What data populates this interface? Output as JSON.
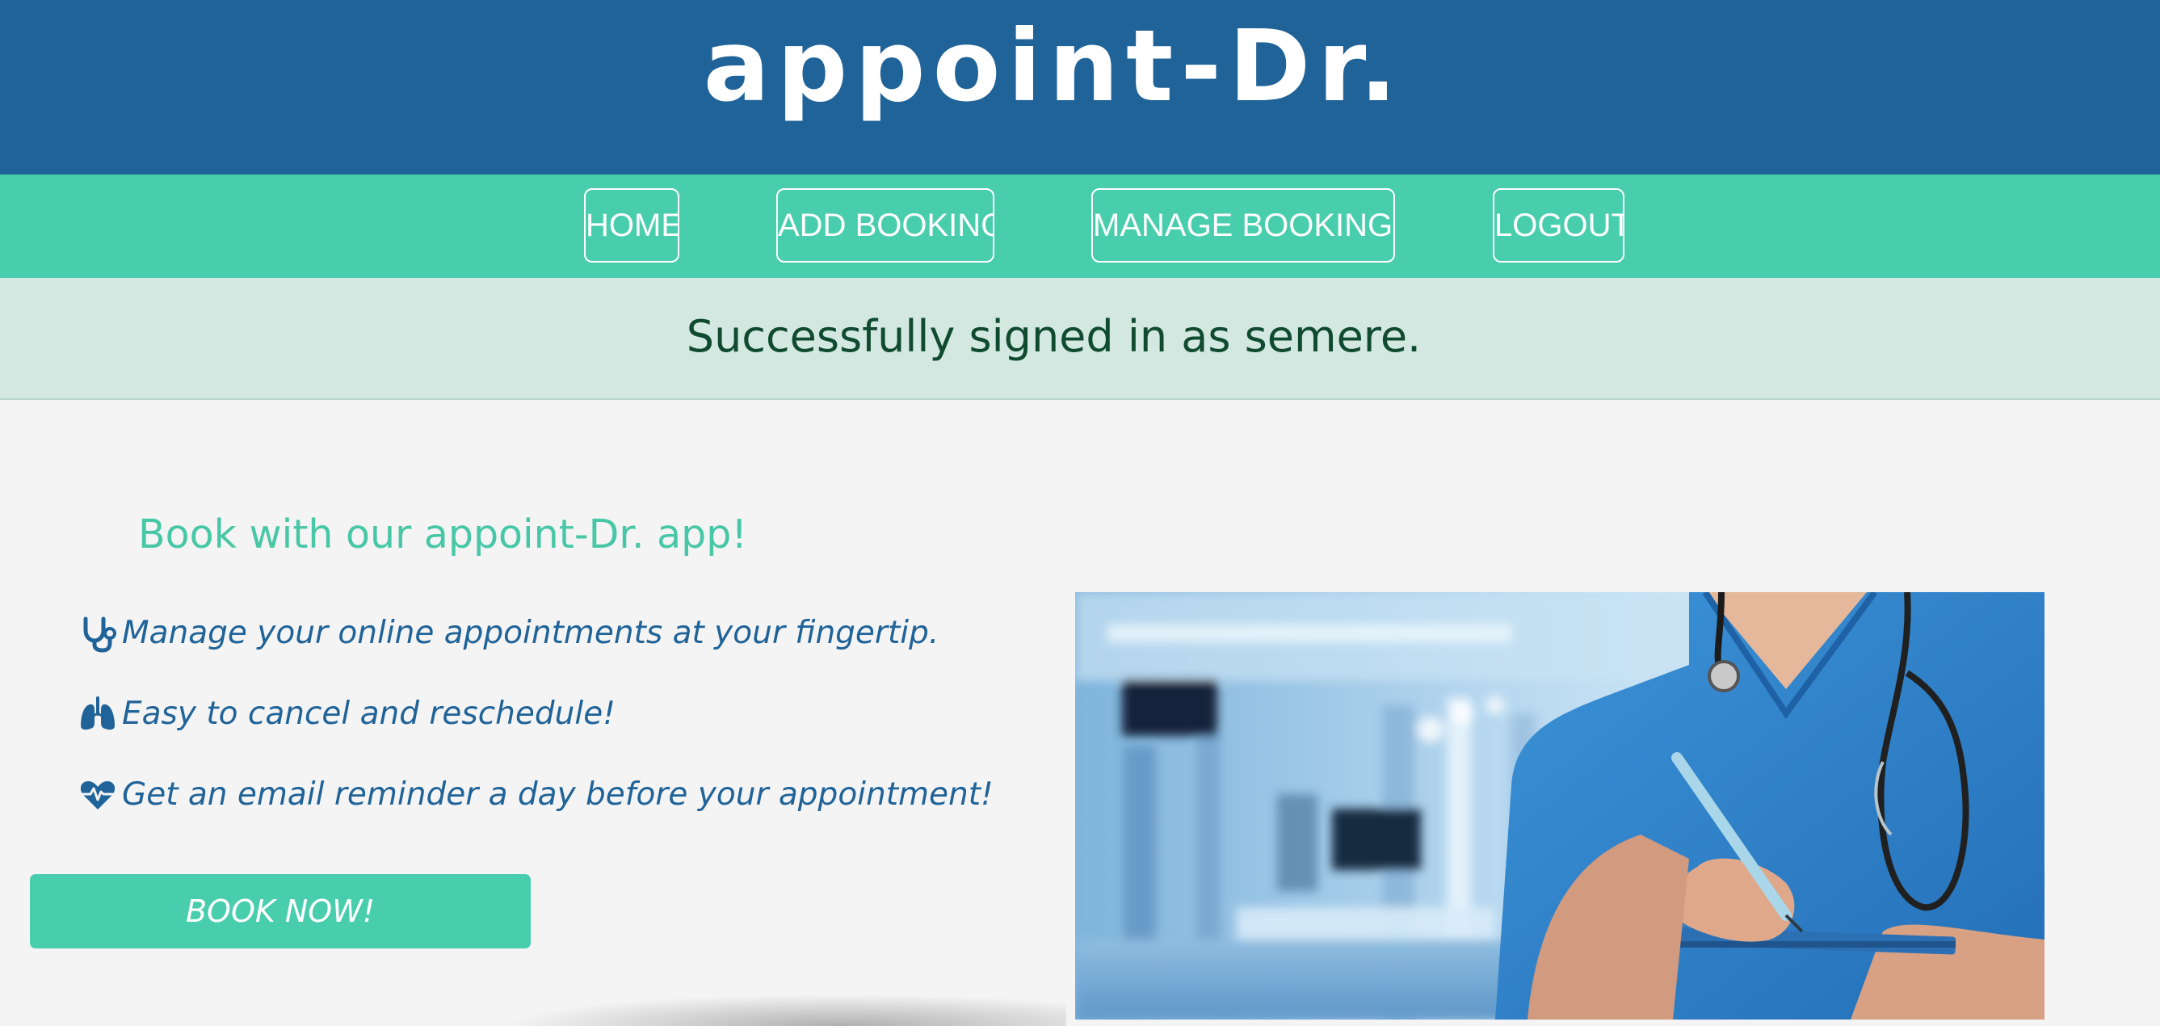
{
  "header": {
    "brand": "appoint-Dr."
  },
  "nav": {
    "items": [
      {
        "label": "HOME"
      },
      {
        "label": "ADD BOOKING"
      },
      {
        "label": "MANAGE BOOKINGS"
      },
      {
        "label": "LOGOUT"
      }
    ]
  },
  "alert": {
    "message": "Successfully signed in as semere."
  },
  "main": {
    "tagline": "Book with our appoint-Dr. app!",
    "features": [
      {
        "icon": "stethoscope-icon",
        "text": "Manage your online appointments at your fingertip."
      },
      {
        "icon": "lungs-icon",
        "text": "Easy to cancel and reschedule!"
      },
      {
        "icon": "heart-pulse-icon",
        "text": "Get an email reminder a day before your appointment!"
      }
    ],
    "cta_label": "BOOK NOW!"
  },
  "colors": {
    "header_bg": "#206398",
    "nav_bg": "#48cdad",
    "alert_bg": "#d2e8e0",
    "alert_text": "#104a30",
    "accent": "#48c7a7",
    "feature_text": "#206398"
  }
}
